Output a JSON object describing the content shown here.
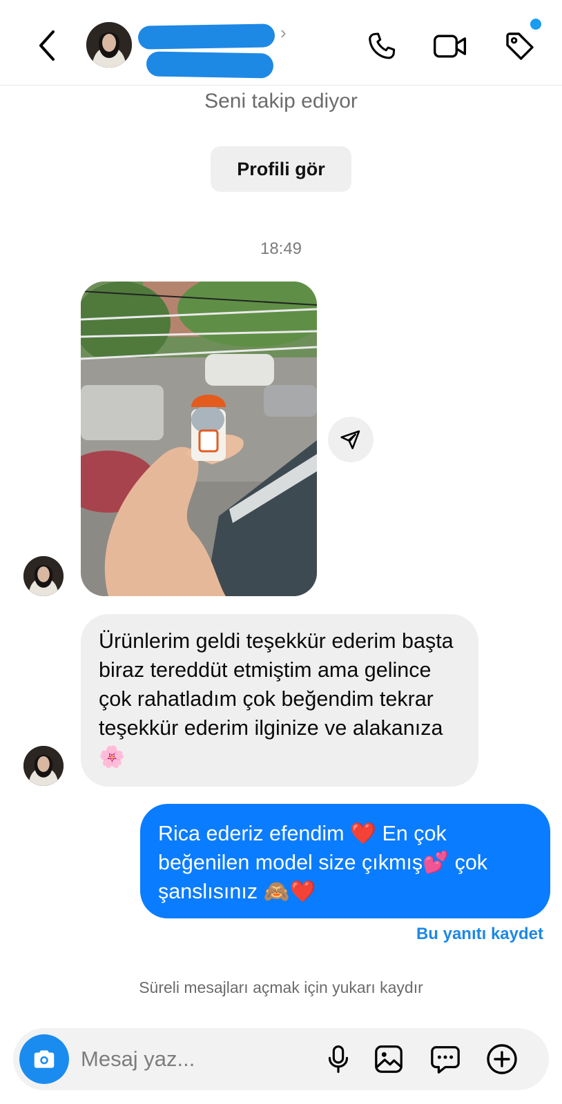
{
  "header": {
    "chevron": "›"
  },
  "thread": {
    "follows_text": "Seni takip ediyor",
    "view_profile_label": "Profili gör",
    "timestamp": "18:49",
    "incoming_message": "Ürünlerim geldi teşekkür ederim başta biraz tereddüt etmiştim ama gelince çok rahatladım çok beğendim tekrar teşekkür ederim ilginize ve alakanıza 🌸",
    "outgoing_message": "Rica ederiz efendim ❤️ En çok beğenilen model size çıkmış💕 çok şanslısınız 🙈❤️",
    "save_reply_label": "Bu yanıtı kaydet",
    "disappearing_hint": "Süreli mesajları açmak için yukarı kaydır"
  },
  "composer": {
    "placeholder": "Mesaj yaz..."
  },
  "icons": [
    "back-icon",
    "phone-icon",
    "video-icon",
    "tag-icon",
    "share-icon",
    "camera-icon",
    "mic-icon",
    "gallery-icon",
    "sticker-icon",
    "plus-icon"
  ],
  "colors": {
    "accent_blue": "#0a7cff",
    "link_blue": "#1e88e5",
    "incoming_bubble": "#efefef",
    "notification_dot": "#1a9cf0"
  }
}
